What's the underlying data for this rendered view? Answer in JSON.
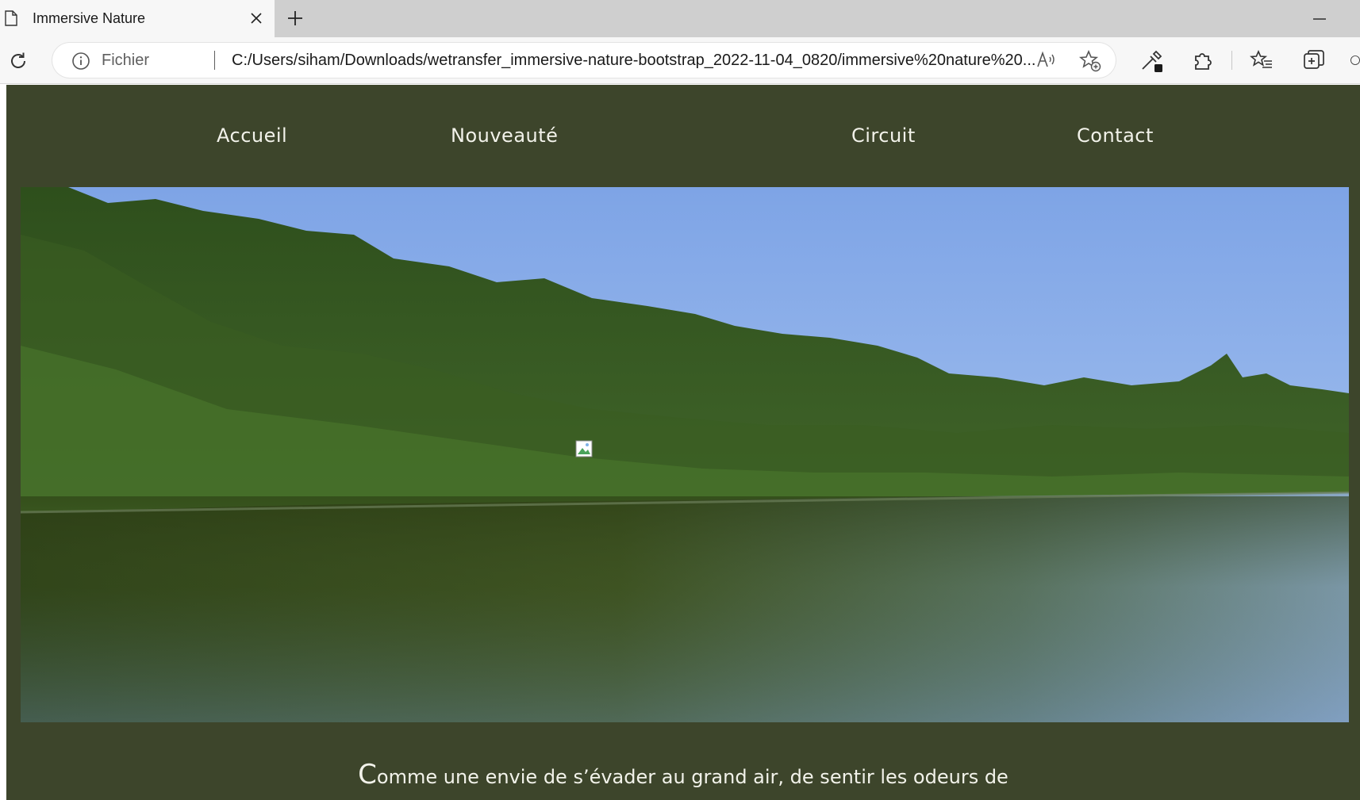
{
  "browser": {
    "tab": {
      "title": "Immersive Nature",
      "icon": "page-icon",
      "close_icon": "close-icon"
    },
    "new_tab_icon": "plus-icon",
    "window": {
      "minimize_icon": "minimize-icon"
    },
    "toolbar": {
      "reload_icon": "reload-icon",
      "address": {
        "info_icon": "info-icon",
        "scheme_label": "Fichier",
        "url": "C:/Users/siham/Downloads/wetransfer_immersive-nature-bootstrap_2022-11-04_0820/immersive%20nature%20...",
        "read_aloud_icon": "read-aloud-icon",
        "add_favorite_icon": "add-favorite-icon"
      },
      "buttons": [
        "eyedropper-icon",
        "extensions-icon",
        "favorites-icon",
        "collections-icon",
        "profile-icon"
      ]
    }
  },
  "page": {
    "colors": {
      "background": "#3d452b",
      "text": "#f2f2ea"
    },
    "nav": {
      "items": [
        {
          "label": "Accueil"
        },
        {
          "label": "Nouveauté"
        },
        {
          "label": "Circuit"
        },
        {
          "label": "Contact"
        }
      ]
    },
    "hero": {
      "description_icon": "broken-image-icon"
    },
    "intro": {
      "dropcap": "C",
      "text": "omme une envie de s’évader au grand air, de sentir les odeurs de"
    }
  }
}
